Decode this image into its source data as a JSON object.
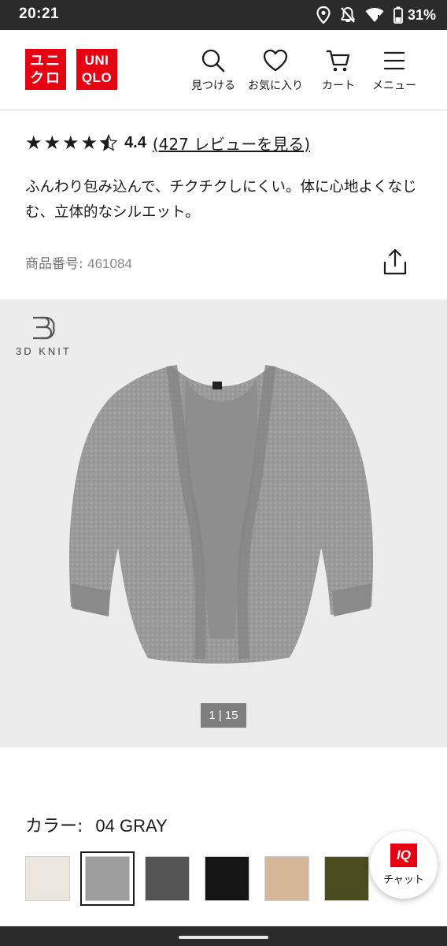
{
  "status_bar": {
    "time": "20:21",
    "battery": "31%",
    "icons": [
      "location-icon",
      "silent-icon",
      "wifi-icon",
      "battery-icon"
    ]
  },
  "header": {
    "logo_ja_top": "ユニ",
    "logo_ja_bottom": "クロ",
    "logo_en_top": "UNI",
    "logo_en_bottom": "QLO",
    "brand_color": "#e60012",
    "nav": {
      "search_label": "見つける",
      "favorites_label": "お気に入り",
      "cart_label": "カート",
      "menu_label": "メニュー"
    }
  },
  "product": {
    "rating": {
      "stars": 4.4,
      "value": "4.4",
      "review_link": "(427 レビューを見る)"
    },
    "description": "ふんわり包み込んで、チクチクしにくい。体に心地よくなじむ、立体的なシルエット。",
    "id_label": "商品番号: ",
    "id_value": "461084"
  },
  "gallery": {
    "badge": "3D KNIT",
    "counter": "1 | 15",
    "image_subject": "gray 3D knit cardigan"
  },
  "color_selection": {
    "label": "カラー:",
    "selected": "04 GRAY",
    "swatches": [
      "#ebe7df",
      "#9e9e9e",
      "#545454",
      "#151515",
      "#d5b699",
      "#4b4d1f"
    ],
    "selected_index": 1
  },
  "chat": {
    "badge": "IQ",
    "label": "チャット"
  }
}
